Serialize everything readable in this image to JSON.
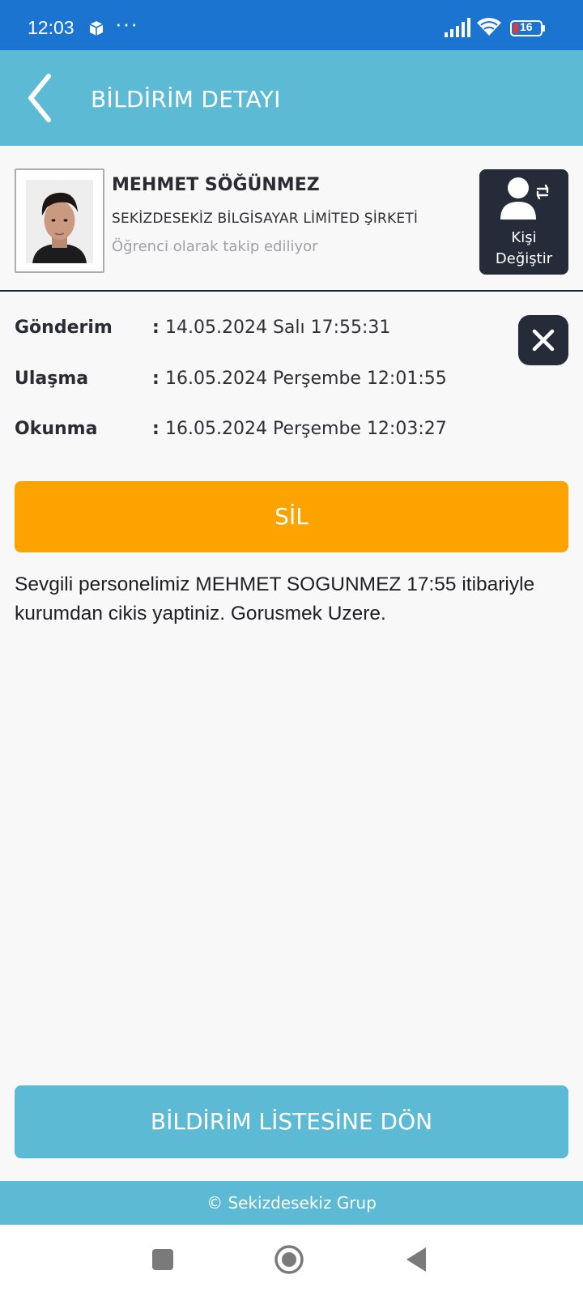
{
  "status_bar": {
    "time": "12:03",
    "dots": "···",
    "battery": "16"
  },
  "header": {
    "title": "BİLDİRİM DETAYI",
    "background": "#5dbad4"
  },
  "profile": {
    "name": "MEHMET SÖĞÜNMEZ",
    "company": "SEKİZDESEKİZ BİLGİSAYAR LİMİTED ŞİRKETİ",
    "follow_status": "Öğrenci olarak takip ediliyor",
    "change_button_label": "Kişi\nDeğiştir"
  },
  "details": [
    {
      "label": "Gönderim",
      "value": "14.05.2024 Salı 17:55:31"
    },
    {
      "label": "Ulaşma",
      "value": "16.05.2024 Perşembe 12:01:55"
    },
    {
      "label": "Okunma",
      "value": "16.05.2024 Perşembe 12:03:27"
    }
  ],
  "detail_colon": ":",
  "actions": {
    "delete_label": "SİL",
    "delete_color": "#fca300",
    "return_label": "BİLDİRİM LİSTESİNE DÖN"
  },
  "message": "Sevgili personelimiz MEHMET SOGUNMEZ 17:55 itibariyle kurumdan cikis yaptiniz. Gorusmek Uzere.",
  "footer": {
    "text": "© Sekizdesekiz Grup"
  },
  "icons": {
    "back": "chevron-left-icon",
    "close": "close-icon",
    "change_person": "user-swap-icon"
  }
}
